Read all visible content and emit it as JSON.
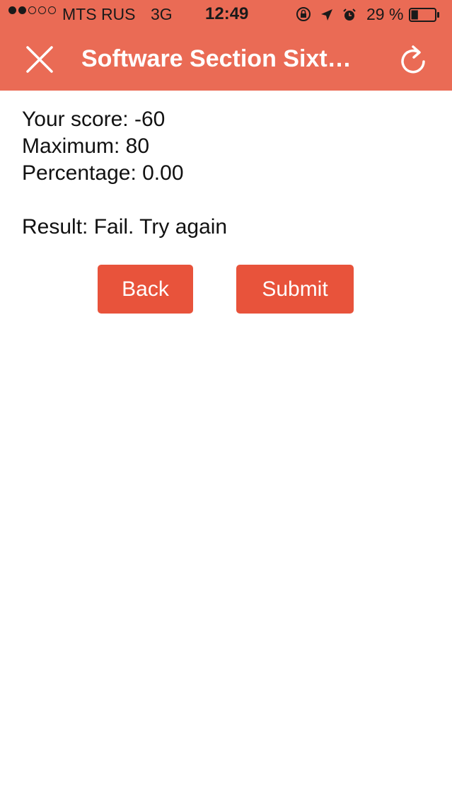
{
  "status_bar": {
    "carrier": "MTS RUS",
    "network": "3G",
    "time": "12:49",
    "battery_percent": "29 %",
    "battery_level": 0.29,
    "signal_bars_filled": 2,
    "signal_bars_total": 5
  },
  "navbar": {
    "title": "Software Section Sixt…"
  },
  "results": {
    "score_line": "Your score: -60",
    "maximum_line": "Maximum: 80",
    "percentage_line": "Percentage: 0.00",
    "result_line": "Result: Fail. Try again"
  },
  "buttons": {
    "back_label": "Back",
    "submit_label": "Submit"
  },
  "colors": {
    "header_bg": "#ea6b55",
    "button_bg": "#e8533b",
    "text": "#111111"
  },
  "icons": {
    "close": "close-icon",
    "refresh": "refresh-icon",
    "orientation_lock": "orientation-lock-icon",
    "location": "location-arrow-icon",
    "alarm": "alarm-clock-icon",
    "battery": "battery-icon"
  }
}
